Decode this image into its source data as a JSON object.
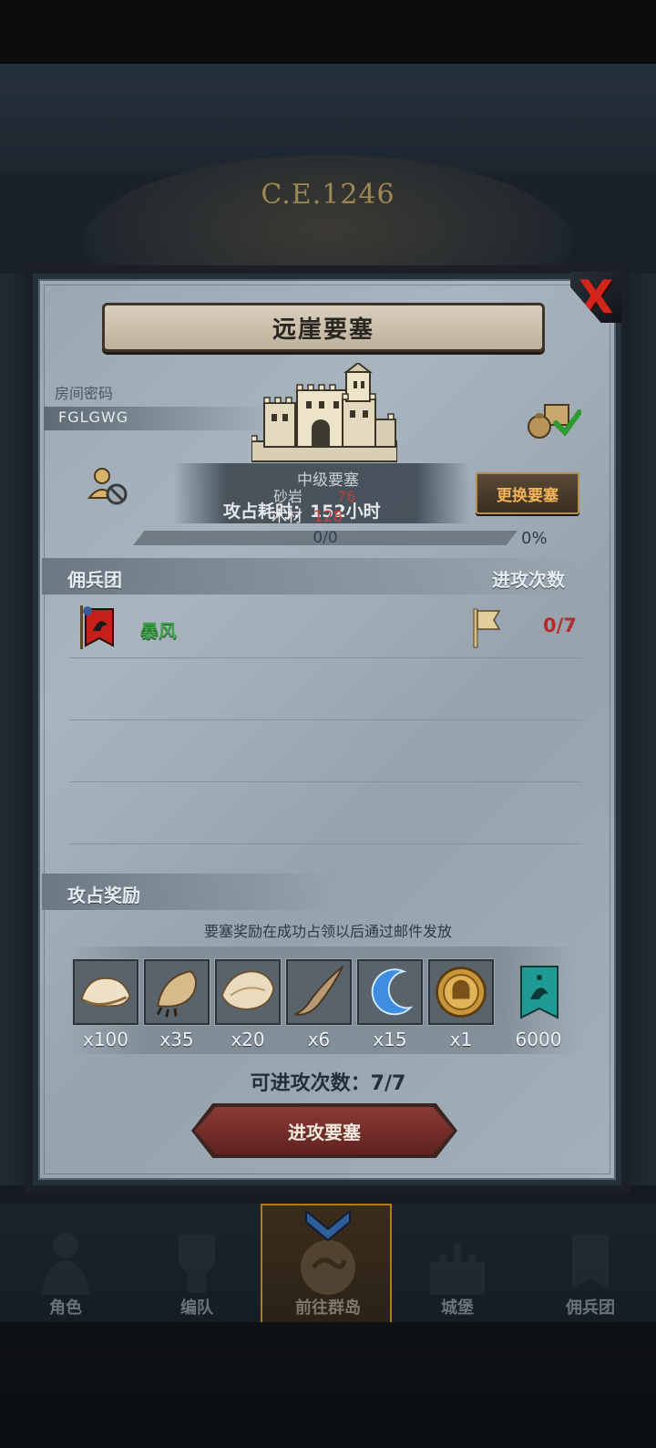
{
  "background": {
    "year": "C.E.1246"
  },
  "dialog": {
    "title": "远崖要塞",
    "close_label": "X",
    "room": {
      "label": "房间密码",
      "code": "FGLGWG"
    },
    "fortress_info": {
      "level": "中级要塞",
      "sand_label": "砂岩",
      "sand_value": "76",
      "wood_label": "木材",
      "wood_value": "128",
      "capture_time": "攻占耗时：152小时"
    },
    "change_button": "更换要塞",
    "progress": {
      "text": "0/0",
      "percent_label": "0%",
      "fraction": 0
    },
    "mercenary_section": {
      "title": "佣兵团",
      "attacks_header": "进攻次数"
    },
    "guilds": [
      {
        "name": "暴风",
        "attacks": "0/7"
      }
    ],
    "reward_section": {
      "title": "攻占奖励",
      "note": "要塞奖励在成功占领以后通过邮件发放",
      "items": [
        {
          "icon": "fur-pelt-icon",
          "qty": "x100"
        },
        {
          "icon": "claw-icon",
          "qty": "x35"
        },
        {
          "icon": "hide-icon",
          "qty": "x20"
        },
        {
          "icon": "horn-icon",
          "qty": "x6"
        },
        {
          "icon": "crescent-gem-icon",
          "qty": "x15"
        },
        {
          "icon": "knight-medal-icon",
          "qty": "x1"
        },
        {
          "icon": "guild-banner-icon",
          "qty": "6000"
        }
      ]
    },
    "attempts": "可进攻次数：7/7",
    "attack_button": "进攻要塞"
  },
  "nav": [
    {
      "label": "角色",
      "icon": "character-icon"
    },
    {
      "label": "编队",
      "icon": "formation-icon"
    },
    {
      "label": "前往群岛",
      "icon": "islands-icon",
      "active": true
    },
    {
      "label": "城堡",
      "icon": "castle-icon"
    },
    {
      "label": "佣兵团",
      "icon": "mercenary-icon"
    }
  ],
  "colors": {
    "accent_gold": "#f3b55a",
    "guild_green": "#3ea34a",
    "alert_red": "#b22c2c",
    "close_red": "#d2261c"
  }
}
